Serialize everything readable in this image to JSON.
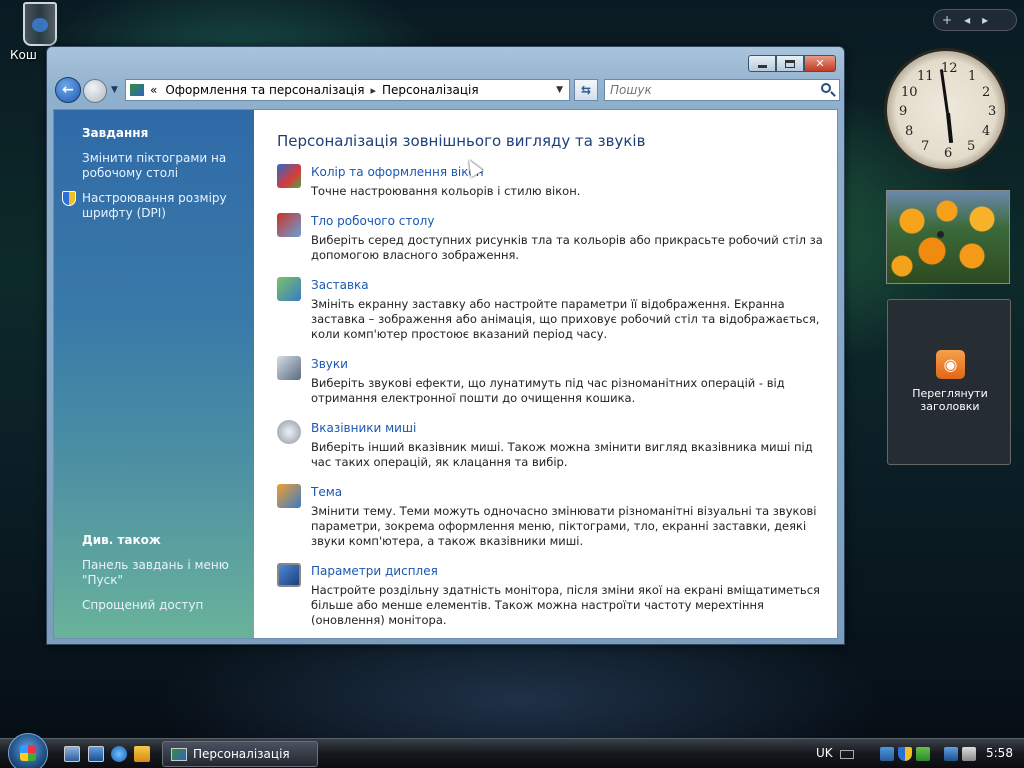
{
  "desktop": {
    "recycle_bin_label": "Кош"
  },
  "window": {
    "breadcrumb": {
      "overflow": "«",
      "parent": "Оформлення та персоналізація",
      "separator": "▸",
      "current": "Персоналізація"
    },
    "search": {
      "placeholder": "Пошук"
    },
    "sidebar": {
      "tasks_heading": "Завдання",
      "tasks": [
        {
          "label": "Змінити піктограми на робочому столі"
        },
        {
          "label": "Настроювання розміру шрифту (DPI)"
        }
      ],
      "see_also_heading": "Див. також",
      "see_also": [
        {
          "label": "Панель завдань і меню \"Пуск\""
        },
        {
          "label": "Спрощений доступ"
        }
      ]
    },
    "main": {
      "title": "Персоналізація зовнішнього вигляду та звуків",
      "items": [
        {
          "link": "Колір та оформлення вікон",
          "desc": "Точне настроювання кольорів і стилю вікон.",
          "icon": "window-color-icon"
        },
        {
          "link": "Тло робочого столу",
          "desc": "Виберіть серед доступних рисунків тла та кольорів або прикрасьте робочий стіл за допомогою власного зображення.",
          "icon": "desktop-background-icon"
        },
        {
          "link": "Заставка",
          "desc": "Змініть екранну заставку або настройте параметри її відображення. Екранна заставка – зображення або анімація, що приховує робочий стіл та відображається, коли комп'ютер простоює вказаний період часу.",
          "icon": "screensaver-icon"
        },
        {
          "link": "Звуки",
          "desc": "Виберіть звукові ефекти, що лунатимуть під час різноманітних операцій - від отримання електронної пошти до очищення кошика.",
          "icon": "sounds-icon"
        },
        {
          "link": "Вказівники миші",
          "desc": "Виберіть інший вказівник миші. Також можна змінити вигляд вказівника миші під час таких операцій, як клацання та вибір.",
          "icon": "mouse-pointer-icon"
        },
        {
          "link": "Тема",
          "desc": "Змінити тему. Теми можуть одночасно змінювати різноманітні візуальні та звукові параметри, зокрема оформлення меню, піктограми, тло, екранні заставки, деякі звуки комп'ютера, а також вказівники миші.",
          "icon": "theme-icon"
        },
        {
          "link": "Параметри дисплея",
          "desc": "Настройте роздільну здатність монітора, після зміни якої на екрані вміщатиметься більше або менше елементів. Також можна настроїти частоту мерехтіння (оновлення) монітора.",
          "icon": "display-settings-icon"
        }
      ]
    }
  },
  "gadgets": {
    "bar": {
      "add": "+",
      "prev": "◂",
      "next": "▸"
    },
    "clock": {
      "numbers": [
        "12",
        "1",
        "2",
        "3",
        "4",
        "5",
        "6",
        "7",
        "8",
        "9",
        "10",
        "11"
      ]
    },
    "feed": {
      "label": "Переглянути заголовки"
    }
  },
  "taskbar": {
    "active_window": "Персоналізація",
    "language": "UK",
    "time": "5:58"
  },
  "colors": {
    "link": "#1a58b4",
    "title": "#1e3f7a",
    "sidebar": "#2f6aa7"
  }
}
